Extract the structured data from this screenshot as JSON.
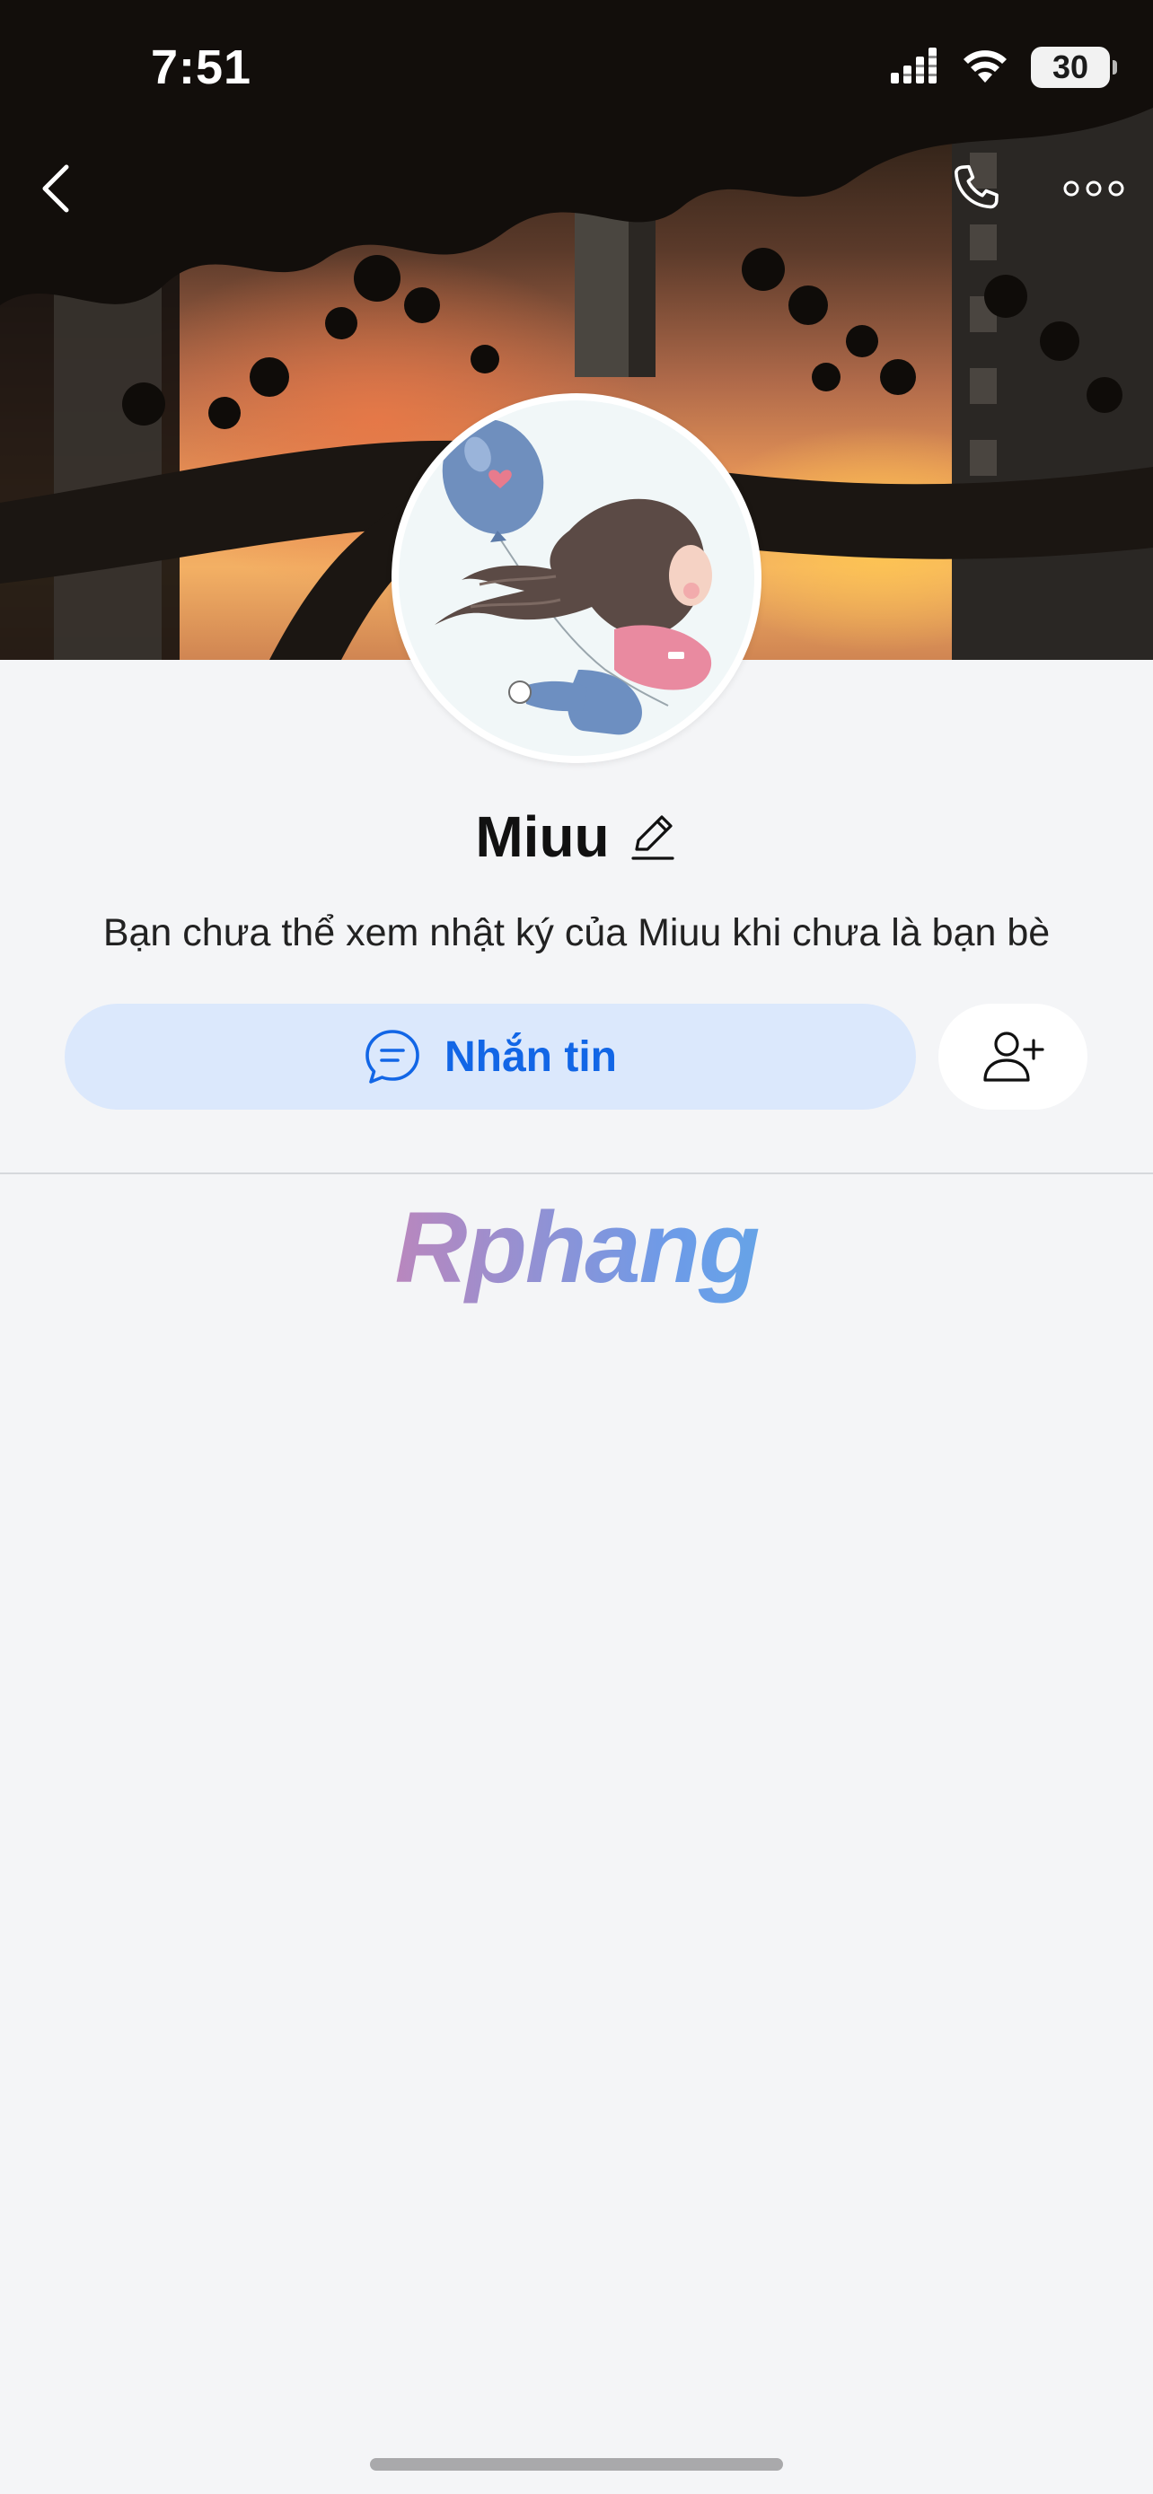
{
  "status_bar": {
    "time": "7:51",
    "battery": "30",
    "icons": [
      "cellular-signal-icon",
      "wifi-icon",
      "battery-icon"
    ]
  },
  "nav": {
    "icons": [
      "chevron-left-icon",
      "phone-icon",
      "more-icon"
    ]
  },
  "profile": {
    "name": "Miuu",
    "notice": "Bạn chưa thể xem nhật ký của Miuu khi chưa là bạn bè"
  },
  "actions": {
    "message_label": "Nhắn tin",
    "message_icon": "chat-bubble-icon",
    "add_friend_icon": "add-friend-icon"
  },
  "watermark": {
    "text": "Rphang"
  },
  "colors": {
    "accent": "#1266e6",
    "message_button_bg": "#dbe8fc",
    "page_bg": "#f4f5f7"
  }
}
